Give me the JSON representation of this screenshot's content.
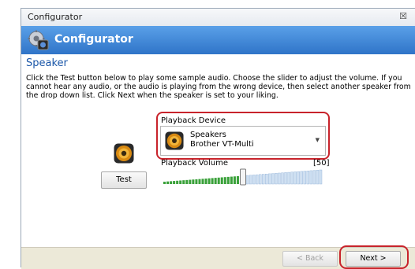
{
  "window": {
    "title": "Configurator",
    "close_glyph": "☒"
  },
  "banner": {
    "title": "Configurator",
    "icon": "configurator-gear-icon"
  },
  "page": {
    "heading": "Speaker",
    "description": "Click the Test button below to play some sample audio. Choose the slider to adjust the volume. If you cannot hear any audio, or the audio is playing from the wrong device, then select another speaker from the drop down list. Click Next when the speaker is set to your liking."
  },
  "test_button": {
    "label": "Test"
  },
  "playback_device": {
    "label": "Playback Device",
    "selected_line1": "Speakers",
    "selected_line2": "Brother VT-Multi",
    "arrow": "▼"
  },
  "playback_volume": {
    "label": "Playback Volume",
    "value_text": "[50]",
    "level": 0.5
  },
  "footer": {
    "back_label": "< Back",
    "next_label": "Next >"
  },
  "colors": {
    "accent": "#2f74c8",
    "highlight": "#c8232b",
    "slider_fill": "#3aa13a"
  }
}
